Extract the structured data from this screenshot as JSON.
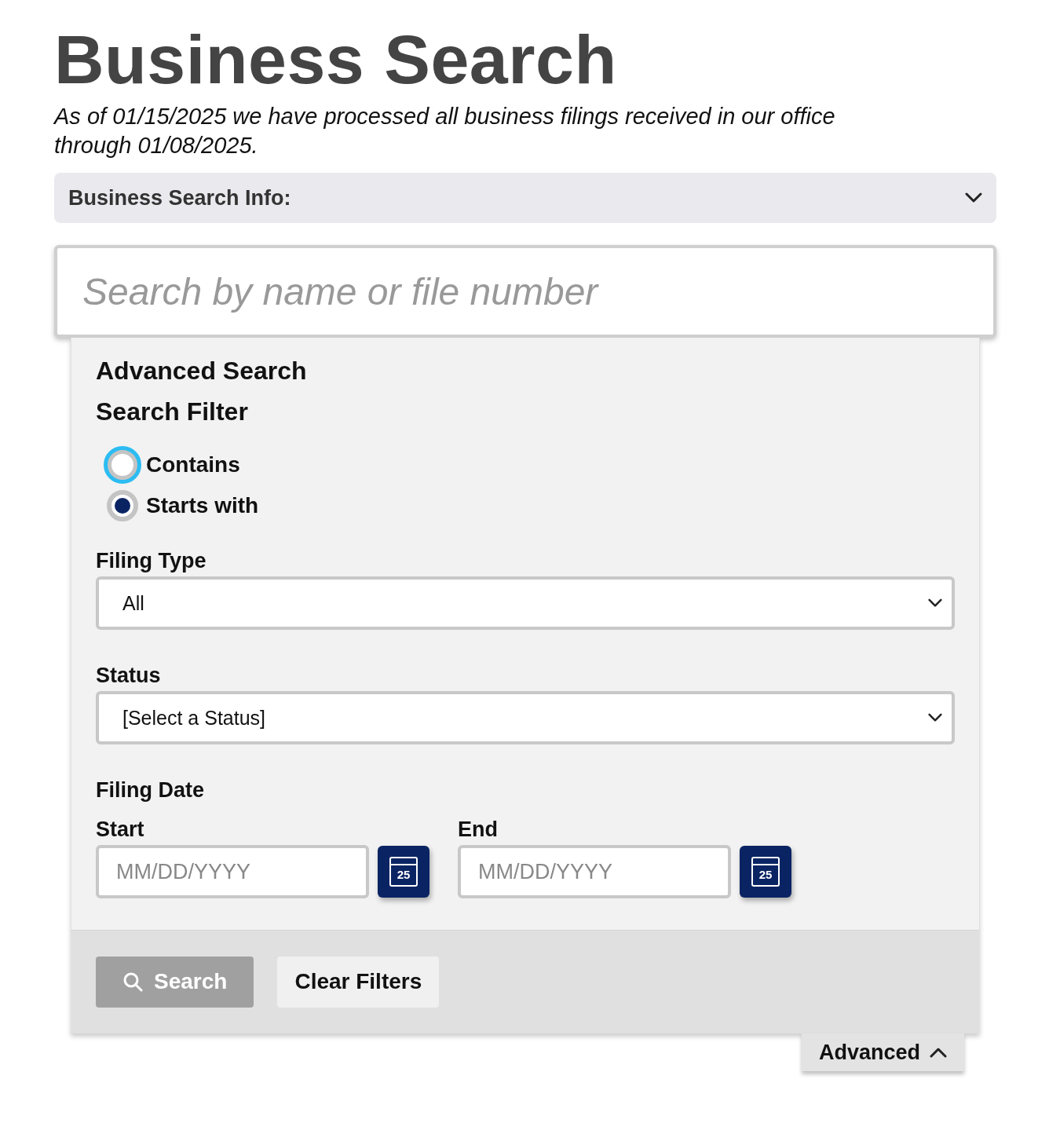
{
  "title": "Business Search",
  "notice": "As of 01/15/2025 we have processed all business filings received in our office through 01/08/2025.",
  "info_bar": {
    "label": "Business Search Info:",
    "expanded": false
  },
  "search": {
    "placeholder": "Search by name or file number"
  },
  "advanced": {
    "heading": "Advanced Search",
    "filter_heading": "Search Filter",
    "filter_options": [
      {
        "label": "Contains",
        "selected": false,
        "focused": true
      },
      {
        "label": "Starts with",
        "selected": true,
        "focused": false
      }
    ],
    "selects": [
      {
        "label": "Filing Type",
        "value": "All"
      },
      {
        "label": "Status",
        "value": "[Select a Status]"
      }
    ],
    "date_heading": "Filing Date",
    "dates": [
      {
        "label": "Start",
        "placeholder": "MM/DD/YYYY",
        "calendar_day": "25"
      },
      {
        "label": "End",
        "placeholder": "MM/DD/YYYY",
        "calendar_day": "25"
      }
    ],
    "buttons": [
      {
        "kind": "search",
        "label": "Search",
        "disabled": true
      },
      {
        "kind": "clear",
        "label": "Clear Filters",
        "disabled": false
      }
    ]
  },
  "advanced_toggle": {
    "label": "Advanced",
    "expanded": true
  }
}
